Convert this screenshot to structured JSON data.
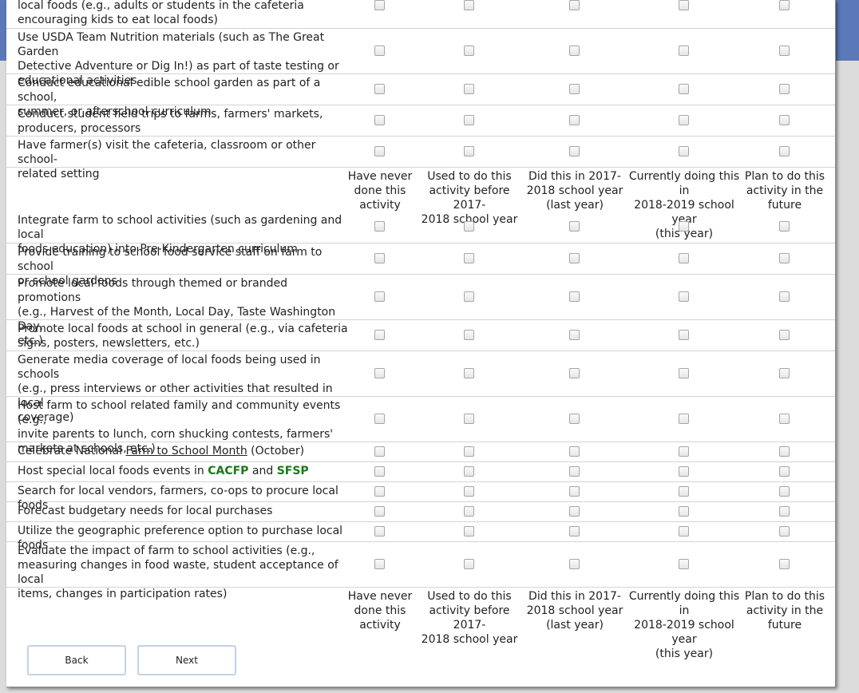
{
  "header_columns": [
    "Have never done this activity",
    "Used to do this activity before 2017-2018 school year",
    "Did this in 2017-2018 school year (last year)",
    "Currently doing this in 2018-2019 school year (this year)",
    "Plan to do this activity in the future"
  ],
  "header_lines": [
    [
      "Have never",
      "done this",
      "activity"
    ],
    [
      "Used to do this",
      "activity before 2017-",
      "2018 school year"
    ],
    [
      "Did this in 2017-",
      "2018 school year",
      "(last year)"
    ],
    [
      "Currently doing this in",
      "2018-2019 school year",
      "(this year)"
    ],
    [
      "Plan to do this",
      "activity in the",
      "future"
    ]
  ],
  "rows": [
    {
      "lines": [
        "local foods (e.g., adults or students in the cafeteria",
        "encouraging kids to eat local foods)"
      ]
    },
    {
      "lines": [
        "Use USDA Team Nutrition materials (such as The Great Garden",
        "Detective Adventure or Dig In!) as part of taste testing or",
        "educational activities"
      ]
    },
    {
      "lines": [
        "Conduct educational edible school garden as part of a school,",
        "summer, or afterschool curriculum"
      ]
    },
    {
      "lines": [
        "Conduct student field trips to farms, farmers' markets,",
        "producers, processors"
      ]
    },
    {
      "lines": [
        "Have farmer(s) visit the cafeteria, classroom or other school-",
        "related setting"
      ]
    },
    {
      "lines": [
        "Integrate farm to school activities (such as gardening and local",
        "foods education) into Pre-Kindergarten curriculum"
      ]
    },
    {
      "lines": [
        "Provide training to school food service staff on farm to school",
        "or school gardens"
      ]
    },
    {
      "lines": [
        "Promote local foods through themed or branded promotions",
        "(e.g., Harvest of the Month, Local Day, Taste Washington Day,",
        "etc.)"
      ]
    },
    {
      "lines": [
        "Promote local foods at school in general (e.g., via cafeteria",
        "signs, posters, newsletters, etc.)"
      ]
    },
    {
      "lines": [
        "Generate media coverage of local foods being used in schools",
        "(e.g., press interviews or other activities that resulted in local",
        "coverage)"
      ]
    },
    {
      "lines": [
        "Host farm to school related family and community events (e.g.,",
        "invite parents to lunch, corn shucking contests, farmers'",
        "markets at schools, etc.)"
      ]
    },
    {
      "parts": [
        "Celebrate National ",
        "Farm to School Month",
        " (October)"
      ]
    },
    {
      "parts": [
        "Host special local foods events in ",
        "CACFP",
        " and ",
        "SFSP"
      ]
    },
    {
      "lines": [
        "Search for local vendors, farmers, co-ops to procure local foods"
      ]
    },
    {
      "lines": [
        "Forecast budgetary needs for local purchases"
      ]
    },
    {
      "lines": [
        "Utilize the geographic preference option to purchase local foods"
      ]
    },
    {
      "lines": [
        "Evaluate the impact of farm to school activities (e.g.,",
        "measuring changes in food waste, student acceptance of local",
        "items, changes in participation rates)"
      ]
    }
  ],
  "buttons": {
    "back": "Back",
    "next": "Next"
  }
}
